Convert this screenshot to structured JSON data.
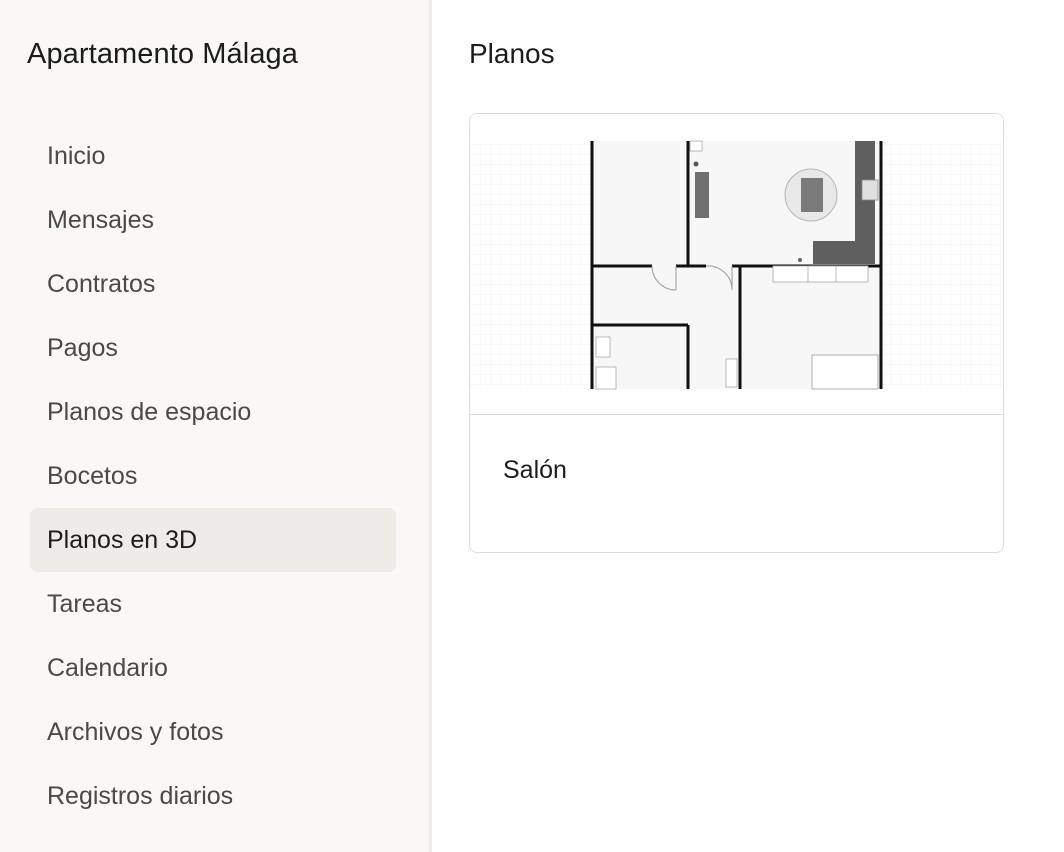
{
  "sidebar": {
    "project_title": "Apartamento Málaga",
    "items": [
      {
        "label": "Inicio"
      },
      {
        "label": "Mensajes"
      },
      {
        "label": "Contratos"
      },
      {
        "label": "Pagos"
      },
      {
        "label": "Planos de espacio"
      },
      {
        "label": "Bocetos"
      },
      {
        "label": "Planos en 3D",
        "active": true
      },
      {
        "label": "Tareas"
      },
      {
        "label": "Calendario"
      },
      {
        "label": "Archivos y fotos"
      },
      {
        "label": "Registros diarios"
      }
    ]
  },
  "main": {
    "title": "Planos",
    "cards": [
      {
        "label": "Salón",
        "thumbnail": "floor-plan-image"
      }
    ]
  },
  "colors": {
    "sidebar_bg": "#f9f8f6",
    "active_item_bg": "#eeece7",
    "card_border": "#dddcd6"
  }
}
